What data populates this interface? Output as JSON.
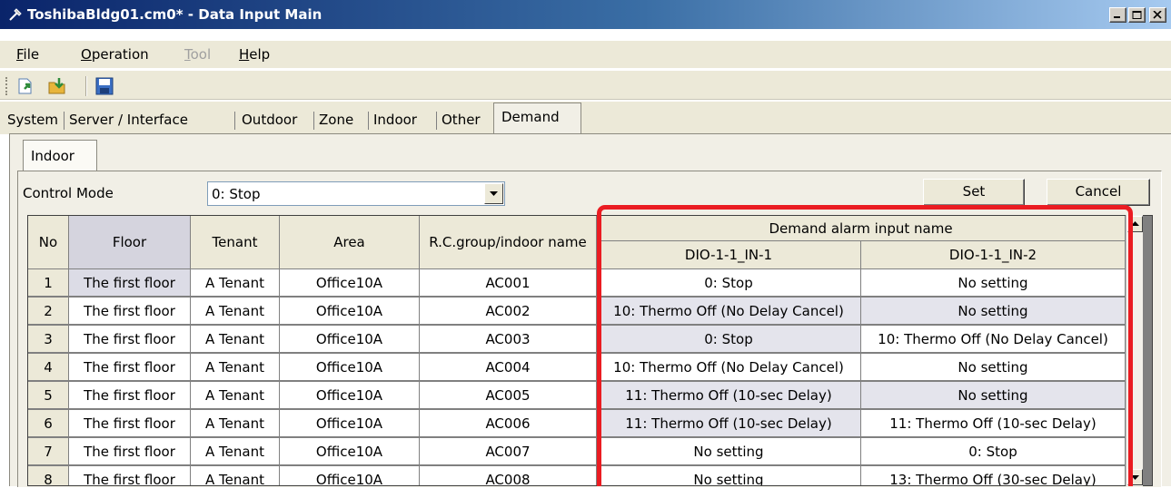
{
  "window": {
    "title": "ToshibaBldg01.cm0* - Data Input Main",
    "minimize_icon": "minimize-icon",
    "maximize_icon": "maximize-icon",
    "close_icon": "close-icon"
  },
  "menu": {
    "file": {
      "acc": "F",
      "rest": "ile"
    },
    "operation": {
      "acc": "O",
      "rest": "peration"
    },
    "tool": {
      "acc": "T",
      "rest": "ool",
      "disabled": true
    },
    "help": {
      "acc": "H",
      "rest": "elp"
    }
  },
  "toolbar": {
    "icons": [
      "open-icon",
      "import-icon",
      "save-icon"
    ]
  },
  "tabs": [
    "System",
    "Server / Interface",
    "Outdoor",
    "Zone",
    "Indoor",
    "Other",
    "Demand"
  ],
  "active_tab": "Demand",
  "subtabs": [
    "Indoor"
  ],
  "control_mode": {
    "label": "Control Mode",
    "value": "0: Stop"
  },
  "buttons": {
    "set": "Set",
    "cancel": "Cancel"
  },
  "table": {
    "headers": {
      "no": "No",
      "floor": "Floor",
      "tenant": "Tenant",
      "area": "Area",
      "rc": "R.C.group/indoor name",
      "demand_group": "Demand alarm input name",
      "in1": "DIO-1-1_IN-1",
      "in2": "DIO-1-1_IN-2"
    },
    "rows": [
      {
        "no": "1",
        "floor": "The first floor",
        "tenant": "A Tenant",
        "area": "Office10A",
        "rc": "AC001",
        "in1": "0: Stop",
        "in2": "No setting"
      },
      {
        "no": "2",
        "floor": "The first floor",
        "tenant": "A Tenant",
        "area": "Office10A",
        "rc": "AC002",
        "in1": "10: Thermo Off (No Delay Cancel)",
        "in2": "No setting"
      },
      {
        "no": "3",
        "floor": "The first floor",
        "tenant": "A Tenant",
        "area": "Office10A",
        "rc": "AC003",
        "in1": "0: Stop",
        "in2": "10: Thermo Off (No Delay Cancel)"
      },
      {
        "no": "4",
        "floor": "The first floor",
        "tenant": "A Tenant",
        "area": "Office10A",
        "rc": "AC004",
        "in1": "10: Thermo Off (No Delay Cancel)",
        "in2": "No setting"
      },
      {
        "no": "5",
        "floor": "The first floor",
        "tenant": "A Tenant",
        "area": "Office10A",
        "rc": "AC005",
        "in1": "11: Thermo Off (10-sec Delay)",
        "in2": "No setting"
      },
      {
        "no": "6",
        "floor": "The first floor",
        "tenant": "A Tenant",
        "area": "Office10A",
        "rc": "AC006",
        "in1": "11: Thermo Off (10-sec Delay)",
        "in2": "11: Thermo Off (10-sec Delay)"
      },
      {
        "no": "7",
        "floor": "The first floor",
        "tenant": "A Tenant",
        "area": "Office10A",
        "rc": "AC007",
        "in1": "No setting",
        "in2": "0: Stop"
      },
      {
        "no": "8",
        "floor": "The first floor",
        "tenant": "A Tenant",
        "area": "Office10A",
        "rc": "AC008",
        "in1": "No setting",
        "in2": "13: Thermo Off (30-sec Delay)"
      }
    ]
  },
  "colors": {
    "cell_white": "#ffffff",
    "cell_shaded": "#e4e4ec",
    "floor_first": "#dcdce6",
    "highlight": "#ea1c22"
  }
}
